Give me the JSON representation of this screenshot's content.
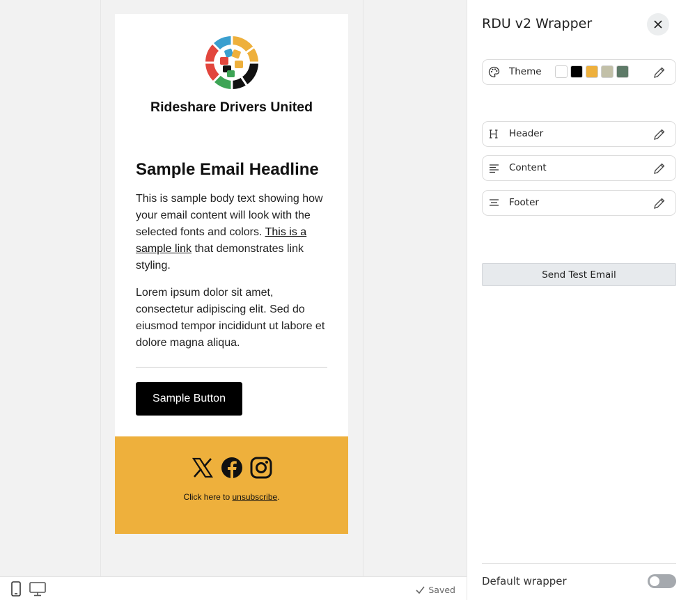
{
  "email": {
    "brand_name": "Rideshare Drivers United",
    "headline": "Sample Email Headline",
    "body_p1_pre": "This is sample body text showing how your email content will look with the selected fonts and colors. ",
    "body_p1_link": "This is a sample link",
    "body_p1_post": " that demonstrates link styling.",
    "body_p2": "Lorem ipsum dolor sit amet, consectetur adipiscing elit. Sed do eiusmod tempor incididunt ut labore et dolore magna aliqua.",
    "button_label": "Sample Button",
    "footer": {
      "unsub_pre": "Click here to ",
      "unsub_link": "unsubscribe",
      "unsub_post": ".",
      "background": "#eeb03c",
      "social_icons": [
        "x-icon",
        "facebook-icon",
        "instagram-icon"
      ]
    }
  },
  "bottom_bar": {
    "saved_label": "Saved",
    "devices": [
      "mobile-icon",
      "desktop-icon"
    ]
  },
  "panel": {
    "title": "RDU v2 Wrapper",
    "theme": {
      "label": "Theme",
      "swatches": [
        "#ffffff",
        "#000000",
        "#eeb03c",
        "#c2c0a8",
        "#5e7a68"
      ]
    },
    "sections": {
      "header": "Header",
      "content": "Content",
      "footer": "Footer"
    },
    "send_test_label": "Send Test Email",
    "default_wrapper_label": "Default wrapper",
    "default_wrapper_on": false
  }
}
